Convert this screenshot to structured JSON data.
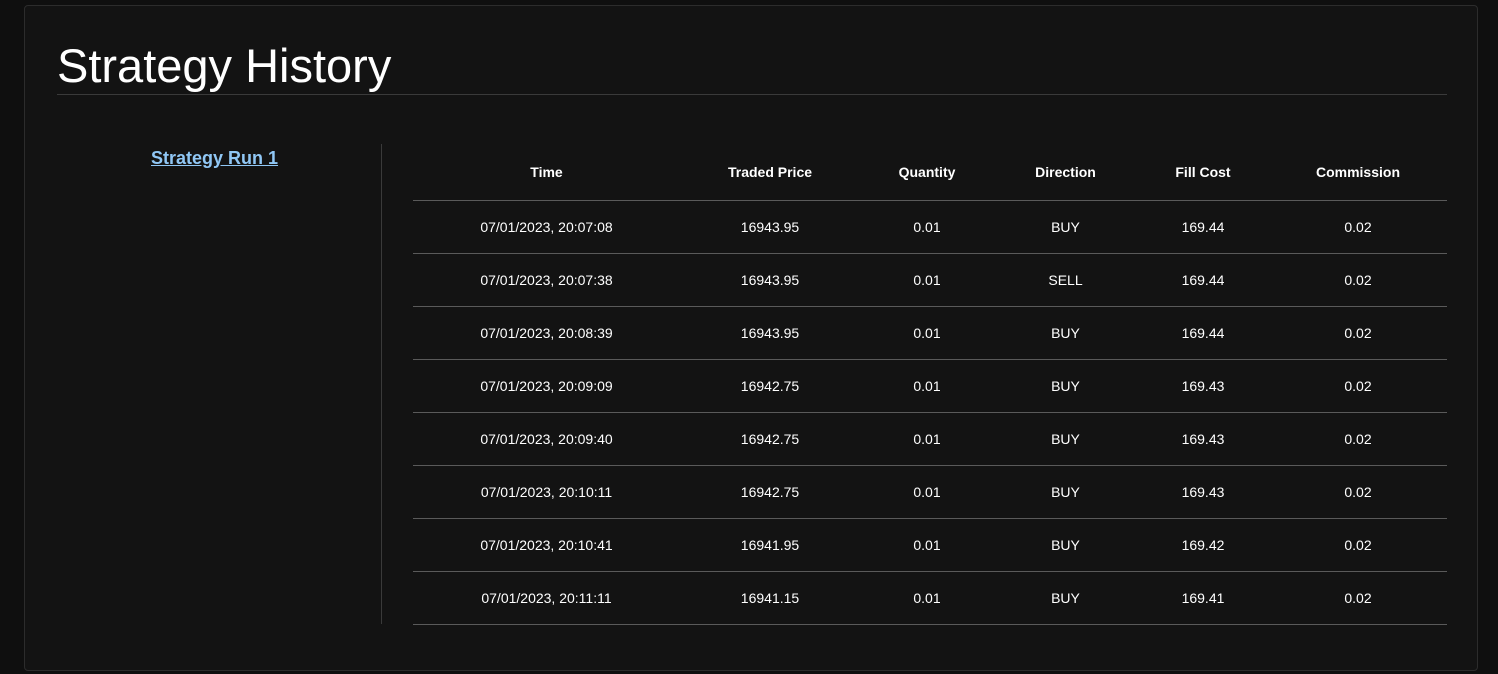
{
  "page": {
    "title": "Strategy History"
  },
  "sidebar": {
    "runs": [
      {
        "label": "Strategy Run 1"
      }
    ]
  },
  "table": {
    "headers": [
      "Time",
      "Traded Price",
      "Quantity",
      "Direction",
      "Fill Cost",
      "Commission"
    ],
    "rows": [
      [
        "07/01/2023, 20:07:08",
        "16943.95",
        "0.01",
        "BUY",
        "169.44",
        "0.02"
      ],
      [
        "07/01/2023, 20:07:38",
        "16943.95",
        "0.01",
        "SELL",
        "169.44",
        "0.02"
      ],
      [
        "07/01/2023, 20:08:39",
        "16943.95",
        "0.01",
        "BUY",
        "169.44",
        "0.02"
      ],
      [
        "07/01/2023, 20:09:09",
        "16942.75",
        "0.01",
        "BUY",
        "169.43",
        "0.02"
      ],
      [
        "07/01/2023, 20:09:40",
        "16942.75",
        "0.01",
        "BUY",
        "169.43",
        "0.02"
      ],
      [
        "07/01/2023, 20:10:11",
        "16942.75",
        "0.01",
        "BUY",
        "169.43",
        "0.02"
      ],
      [
        "07/01/2023, 20:10:41",
        "16941.95",
        "0.01",
        "BUY",
        "169.42",
        "0.02"
      ],
      [
        "07/01/2023, 20:11:11",
        "16941.15",
        "0.01",
        "BUY",
        "169.41",
        "0.02"
      ]
    ]
  },
  "colors": {
    "background": "#131313",
    "link": "#90c7f5",
    "divider": "#5a5a5a"
  }
}
